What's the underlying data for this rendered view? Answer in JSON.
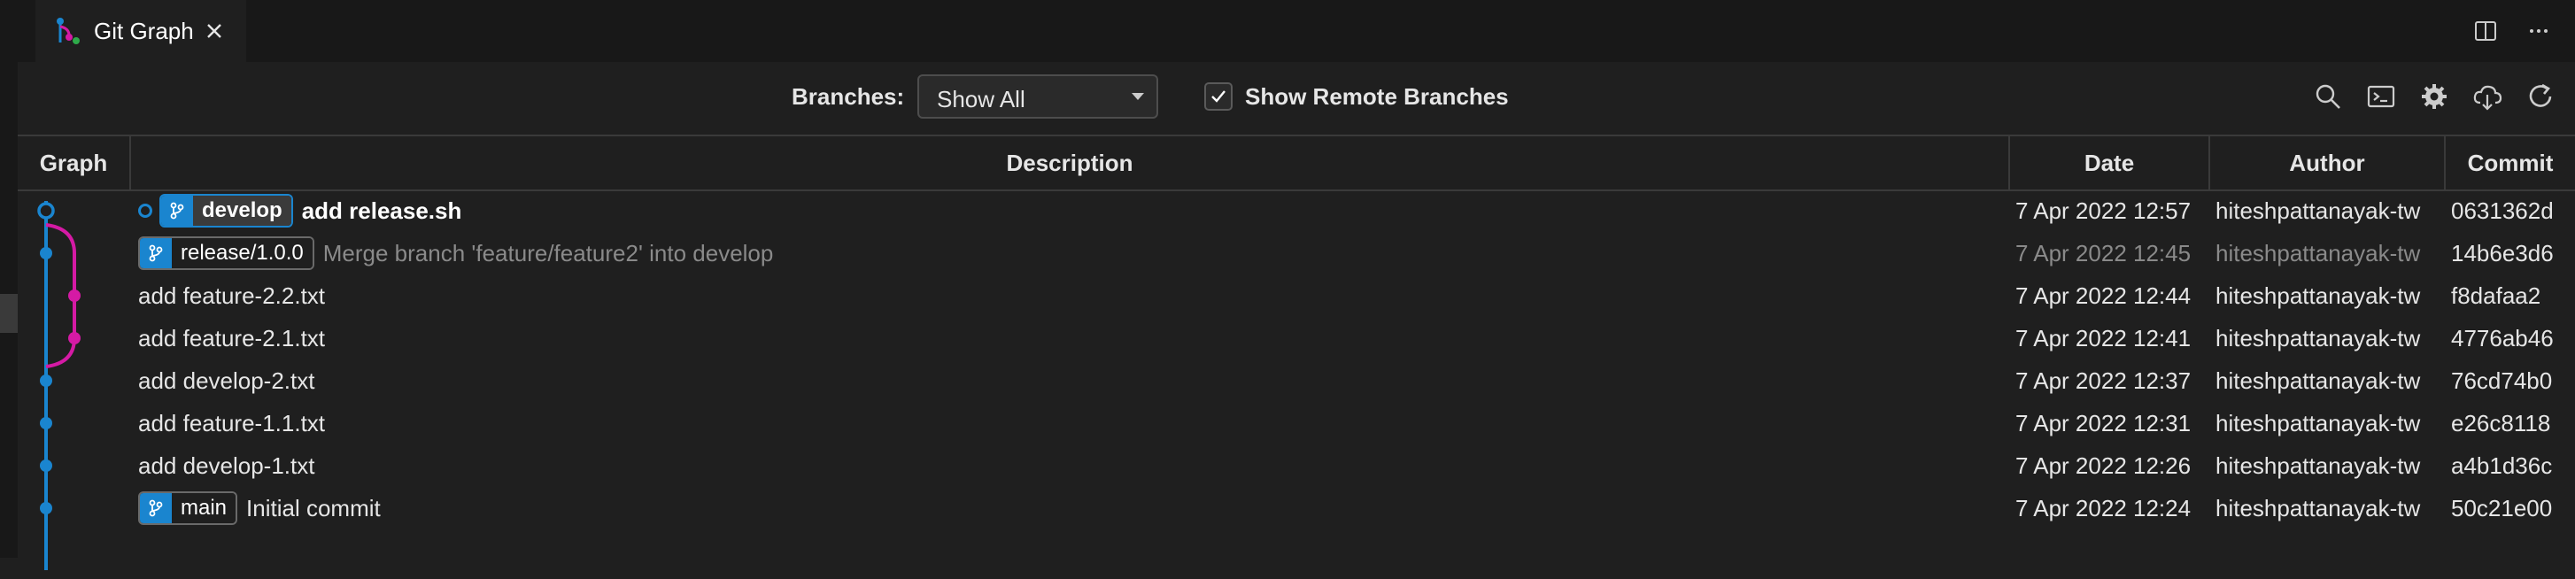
{
  "tab": {
    "title": "Git Graph"
  },
  "controls": {
    "branches_label": "Branches:",
    "branch_select": "Show All",
    "show_remote_label": "Show Remote Branches",
    "show_remote_checked": true
  },
  "columns": {
    "graph": "Graph",
    "description": "Description",
    "date": "Date",
    "author": "Author",
    "commit": "Commit"
  },
  "colors": {
    "accent": "#1a85cf",
    "branch2": "#d51aa5",
    "background": "#1f1f1f"
  },
  "commits": [
    {
      "refs": [
        "develop"
      ],
      "head": true,
      "message": "add release.sh",
      "date": "7 Apr 2022 12:57",
      "author": "hiteshpattanayak-tw",
      "hash": "0631362d",
      "dim": false
    },
    {
      "refs": [
        "release/1.0.0"
      ],
      "head": false,
      "message": "Merge branch 'feature/feature2' into develop",
      "date": "7 Apr 2022 12:45",
      "author": "hiteshpattanayak-tw",
      "hash": "14b6e3d6",
      "dim": true
    },
    {
      "refs": [],
      "head": false,
      "message": "add feature-2.2.txt",
      "date": "7 Apr 2022 12:44",
      "author": "hiteshpattanayak-tw",
      "hash": "f8dafaa2",
      "dim": false
    },
    {
      "refs": [],
      "head": false,
      "message": "add feature-2.1.txt",
      "date": "7 Apr 2022 12:41",
      "author": "hiteshpattanayak-tw",
      "hash": "4776ab46",
      "dim": false
    },
    {
      "refs": [],
      "head": false,
      "message": "add develop-2.txt",
      "date": "7 Apr 2022 12:37",
      "author": "hiteshpattanayak-tw",
      "hash": "76cd74b0",
      "dim": false
    },
    {
      "refs": [],
      "head": false,
      "message": "add feature-1.1.txt",
      "date": "7 Apr 2022 12:31",
      "author": "hiteshpattanayak-tw",
      "hash": "e26c8118",
      "dim": false
    },
    {
      "refs": [],
      "head": false,
      "message": "add develop-1.txt",
      "date": "7 Apr 2022 12:26",
      "author": "hiteshpattanayak-tw",
      "hash": "a4b1d36c",
      "dim": false
    },
    {
      "refs": [
        "main"
      ],
      "head": false,
      "message": "Initial commit",
      "date": "7 Apr 2022 12:24",
      "author": "hiteshpattanayak-tw",
      "hash": "50c21e00",
      "dim": false
    }
  ]
}
